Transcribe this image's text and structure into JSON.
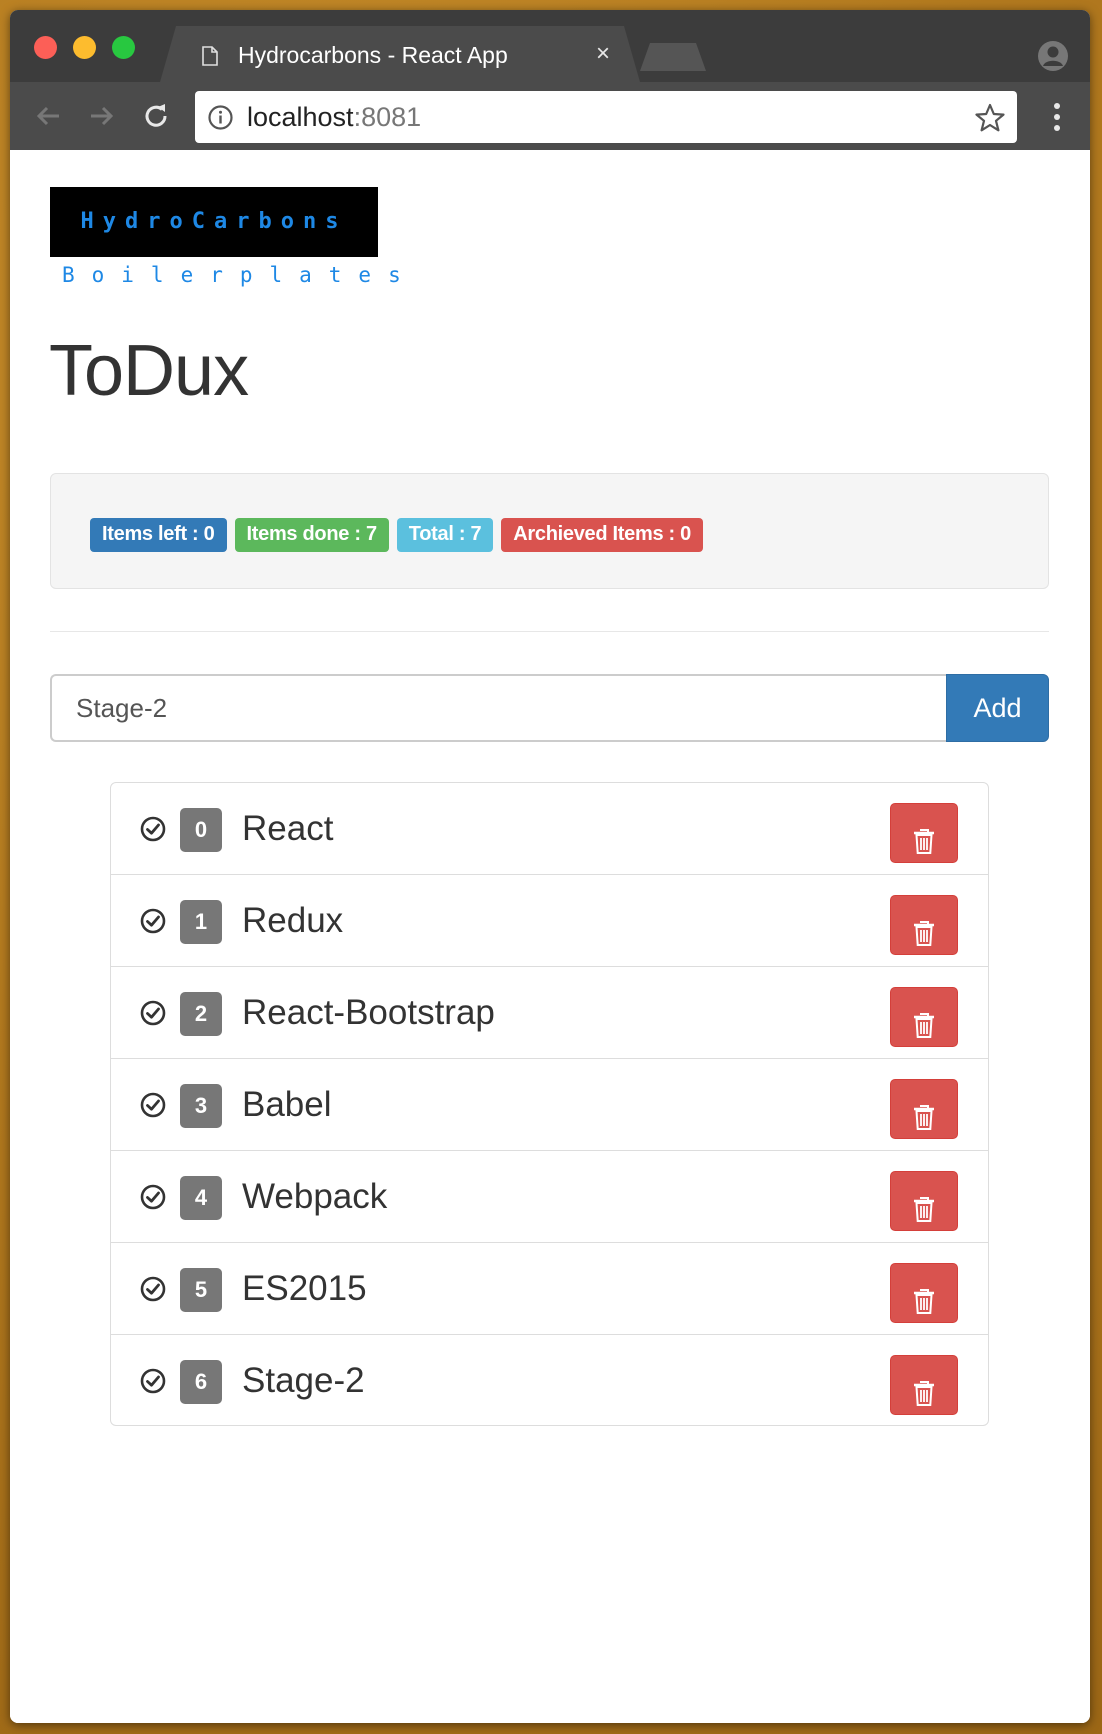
{
  "browser": {
    "tab_title": "Hydrocarbons - React App",
    "tab_close": "×",
    "url_host": "localhost",
    "url_port": ":8081"
  },
  "logo": {
    "top_text": "HydroCarbons",
    "bottom_text": "Boilerplates",
    "text_color": "#1e88e5"
  },
  "page": {
    "title": "ToDux"
  },
  "stats": [
    {
      "text": "Items left : 0",
      "color": "#337ab7"
    },
    {
      "text": "Items done : 7",
      "color": "#5cb85c"
    },
    {
      "text": "Total : 7",
      "color": "#5bc0de"
    },
    {
      "text": "Archieved Items : 0",
      "color": "#d9534f"
    }
  ],
  "form": {
    "input_value": "Stage-2",
    "add_label": "Add"
  },
  "todos": [
    {
      "index": "0",
      "text": "React",
      "icon": "check-circle-icon"
    },
    {
      "index": "1",
      "text": "Redux",
      "icon": "check-circle-icon"
    },
    {
      "index": "2",
      "text": "React-Bootstrap",
      "icon": "check-circle-icon"
    },
    {
      "index": "3",
      "text": "Babel",
      "icon": "check-circle-icon"
    },
    {
      "index": "4",
      "text": "Webpack",
      "icon": "check-circle-icon"
    },
    {
      "index": "5",
      "text": "ES2015",
      "icon": "check-circle-icon"
    },
    {
      "index": "6",
      "text": "Stage-2",
      "icon": "check-circle-icon"
    }
  ],
  "colors": {
    "primary": "#337ab7",
    "danger": "#d9534f",
    "badge": "#777777"
  }
}
